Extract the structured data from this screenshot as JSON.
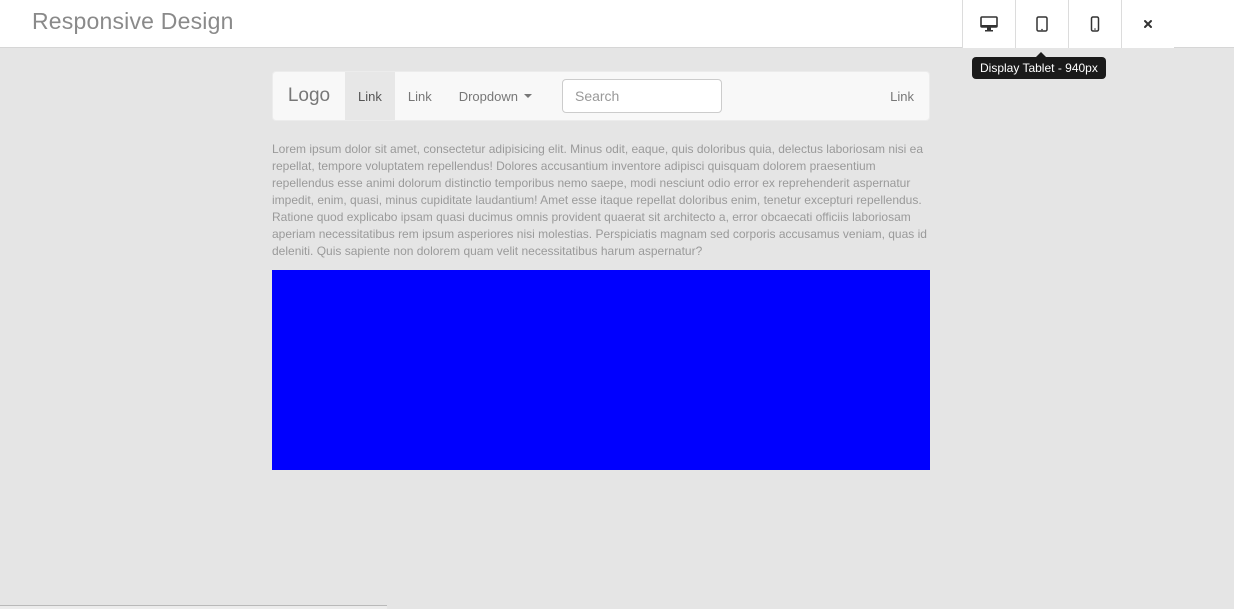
{
  "app": {
    "title": "Responsive Design"
  },
  "device_bar": {
    "buttons": [
      {
        "name": "desktop",
        "icon": "desktop-icon"
      },
      {
        "name": "tablet",
        "icon": "tablet-icon"
      },
      {
        "name": "phone",
        "icon": "phone-icon"
      },
      {
        "name": "close",
        "icon": "close-icon"
      }
    ],
    "tooltip": "Display Tablet - 940px"
  },
  "preview": {
    "navbar": {
      "logo": "Logo",
      "links": [
        "Link",
        "Link"
      ],
      "dropdown_label": "Dropdown",
      "search_placeholder": "Search",
      "right_link": "Link"
    },
    "body_text": "Lorem ipsum dolor sit amet, consectetur adipisicing elit. Minus odit, eaque, quis doloribus quia, delectus laboriosam nisi ea repellat, tempore voluptatem repellendus! Dolores accusantium inventore adipisci quisquam dolorem praesentium repellendus esse animi dolorum distinctio temporibus nemo saepe, modi nesciunt odio error ex reprehenderit aspernatur impedit, enim, quasi, minus cupiditate laudantium! Amet esse itaque repellat doloribus enim, tenetur excepturi repellendus. Ratione quod explicabo ipsam quasi ducimus omnis provident quaerat sit architecto a, error obcaecati officiis laboriosam aperiam necessitatibus rem ipsum asperiores nisi molestias. Perspiciatis magnam sed corporis accusamus veniam, quas id deleniti. Quis sapiente non dolorem quam velit necessitatibus harum aspernatur?",
    "block_color": "#0000ff"
  },
  "colors": {
    "background": "#e5e5e5",
    "header": "#ffffff",
    "tooltip_bg": "#1a1a1a"
  }
}
